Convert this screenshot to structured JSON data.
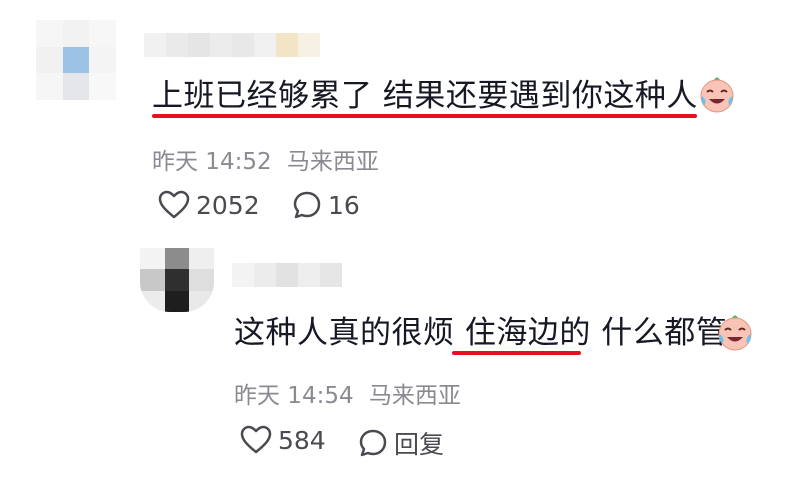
{
  "comment": {
    "text": "上班已经够累了 结果还要遇到你这种人",
    "time": "昨天 14:52",
    "location": "马来西亚",
    "likes": "2052",
    "replies": "16"
  },
  "reply": {
    "text_before": "这种人真的很烦 ",
    "text_underlined": "住海边的",
    "text_after": " 什么都管",
    "time": "昨天 14:54",
    "location": "马来西亚",
    "likes": "584",
    "reply_label": "回复"
  },
  "colors": {
    "underline": "#e8101f",
    "meta": "#8a8b91",
    "text": "#161823"
  },
  "icons": {
    "like": "heart-outline-icon",
    "comment": "speech-bubble-icon",
    "emoji": "crying-laughing-face-emoji"
  }
}
